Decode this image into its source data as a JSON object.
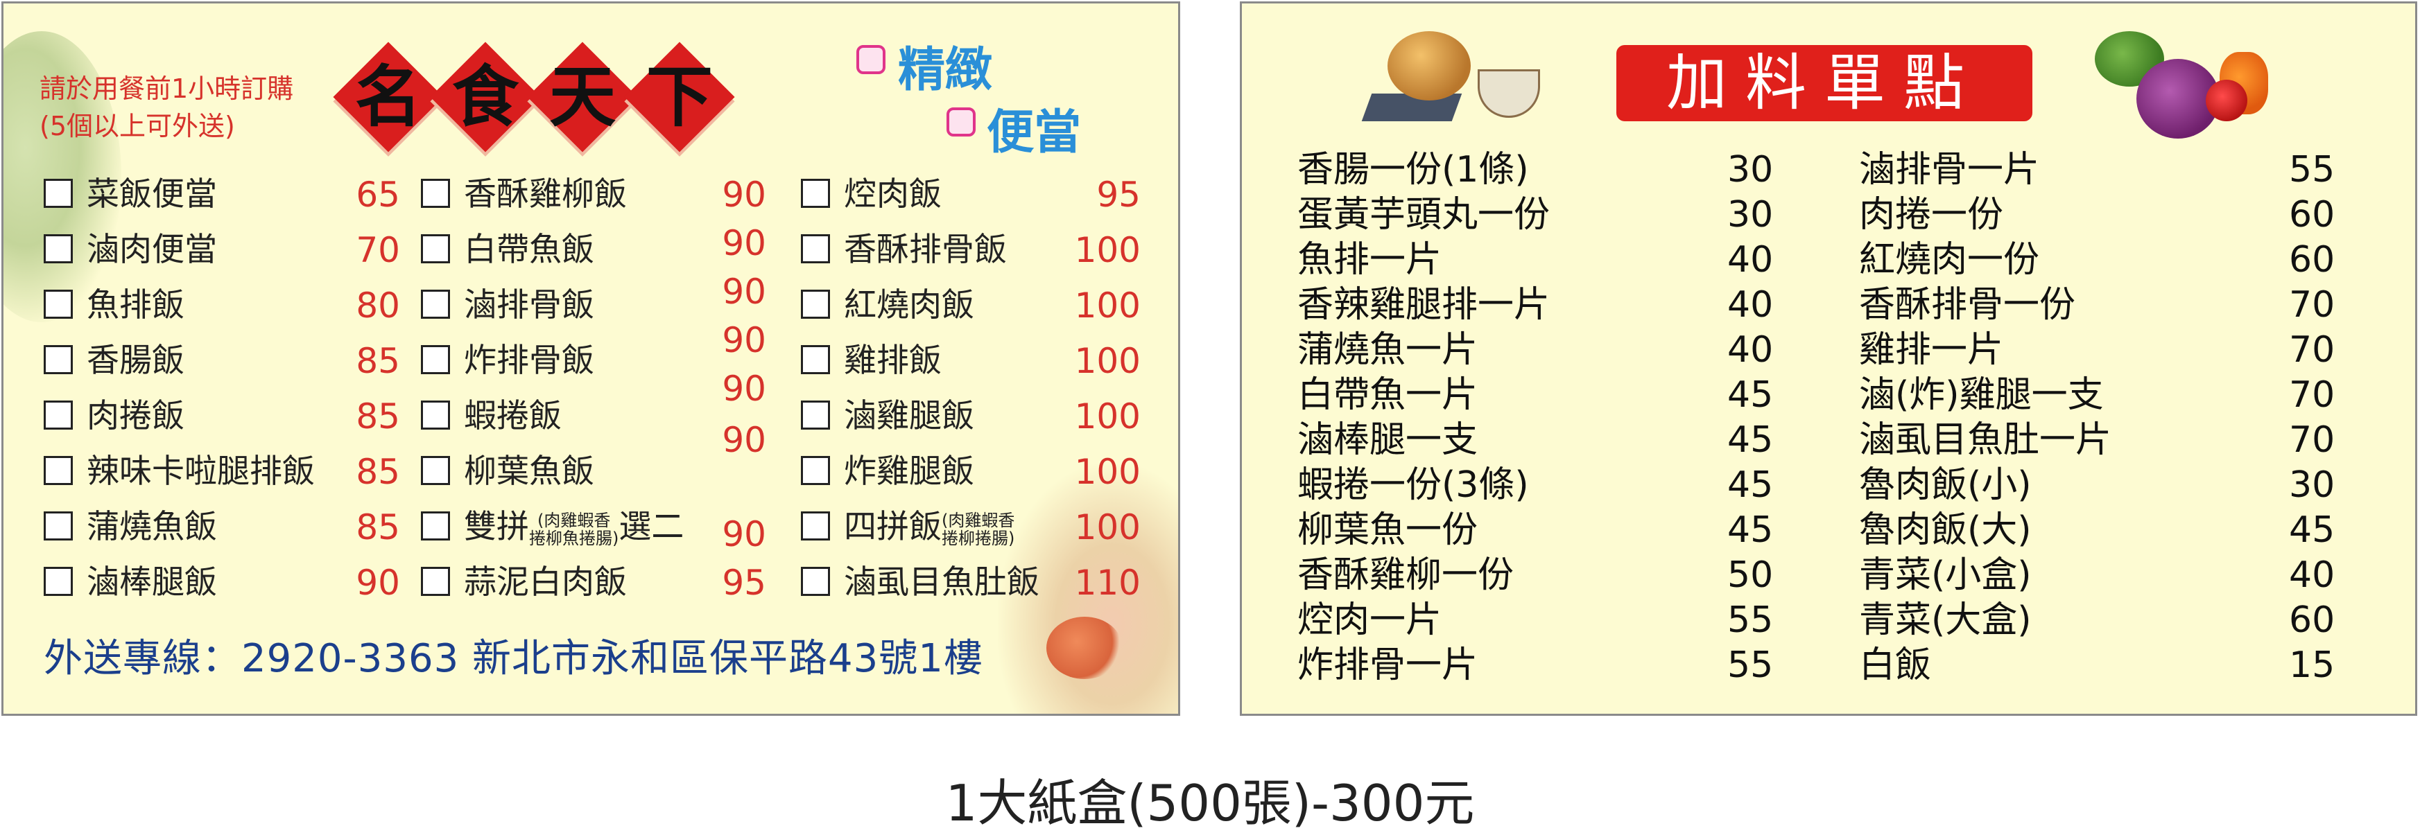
{
  "left_card": {
    "order_note_lines": [
      "請於用餐前1小時訂購",
      "(5個以上可外送)"
    ],
    "brand_chars": [
      "名",
      "食",
      "天",
      "下"
    ],
    "slogan_lines": [
      "精緻",
      "便當"
    ],
    "columns": [
      [
        {
          "name": "菜飯便當",
          "price": "65"
        },
        {
          "name": "滷肉便當",
          "price": "70"
        },
        {
          "name": "魚排飯",
          "price": "80"
        },
        {
          "name": "香腸飯",
          "price": "85"
        },
        {
          "name": "肉捲飯",
          "price": "85"
        },
        {
          "name": "辣味卡啦腿排飯",
          "price": "85"
        },
        {
          "name": "蒲燒魚飯",
          "price": "85"
        },
        {
          "name": "滷棒腿飯",
          "price": "90"
        }
      ],
      [
        {
          "name": "香酥雞柳飯",
          "price": "90"
        },
        {
          "name": "白帶魚飯",
          "price": "90"
        },
        {
          "name": "滷排骨飯",
          "price": "90"
        },
        {
          "name": "炸排骨飯",
          "price": "90"
        },
        {
          "name": "蝦捲飯",
          "price": "90"
        },
        {
          "name": "柳葉魚飯",
          "price": "90"
        },
        {
          "name": "雙拼",
          "note_top": "(肉雞蝦香",
          "note_bottom": "捲柳魚捲腸)",
          "suffix": "選二",
          "price": "90"
        },
        {
          "name": "蒜泥白肉飯",
          "price": "95"
        }
      ],
      [
        {
          "name": "焢肉飯",
          "price": "95"
        },
        {
          "name": "香酥排骨飯",
          "price": "100"
        },
        {
          "name": "紅燒肉飯",
          "price": "100"
        },
        {
          "name": "雞排飯",
          "price": "100"
        },
        {
          "name": "滷雞腿飯",
          "price": "100"
        },
        {
          "name": "炸雞腿飯",
          "price": "100"
        },
        {
          "name": "四拼飯",
          "note_top": "(肉雞蝦香",
          "note_bottom": "捲柳捲腸)",
          "price": "100"
        },
        {
          "name": "滷虱目魚肚飯",
          "price": "110"
        }
      ]
    ],
    "footer": "外送專線：2920-3363  新北市永和區保平路43號1樓"
  },
  "right_card": {
    "title": "加料單點",
    "left_items": [
      {
        "name": "香腸一份(1條)",
        "price": "30"
      },
      {
        "name": "蛋黃芋頭丸一份",
        "price": "30"
      },
      {
        "name": "魚排一片",
        "price": "40"
      },
      {
        "name": "香辣雞腿排一片",
        "price": "40"
      },
      {
        "name": "蒲燒魚一片",
        "price": "40"
      },
      {
        "name": "白帶魚一片",
        "price": "45"
      },
      {
        "name": "滷棒腿一支",
        "price": "45"
      },
      {
        "name": "蝦捲一份(3條)",
        "price": "45"
      },
      {
        "name": "柳葉魚一份",
        "price": "45"
      },
      {
        "name": "香酥雞柳一份",
        "price": "50"
      },
      {
        "name": "焢肉一片",
        "price": "55"
      },
      {
        "name": "炸排骨一片",
        "price": "55"
      }
    ],
    "right_items": [
      {
        "name": "滷排骨一片",
        "price": "55"
      },
      {
        "name": "肉捲一份",
        "price": "60"
      },
      {
        "name": "紅燒肉一份",
        "price": "60"
      },
      {
        "name": "香酥排骨一份",
        "price": "70"
      },
      {
        "name": "雞排一片",
        "price": "70"
      },
      {
        "name": "滷(炸)雞腿一支",
        "price": "70"
      },
      {
        "name": "滷虱目魚肚一片",
        "price": "70"
      },
      {
        "name": "魯肉飯(小)",
        "price": "30"
      },
      {
        "name": "魯肉飯(大)",
        "price": "45"
      },
      {
        "name": "青菜(小盒)",
        "price": "40"
      },
      {
        "name": "青菜(大盒)",
        "price": "60"
      },
      {
        "name": "白飯",
        "price": "15"
      }
    ]
  },
  "caption": "1大紙盒(500張)-300元"
}
